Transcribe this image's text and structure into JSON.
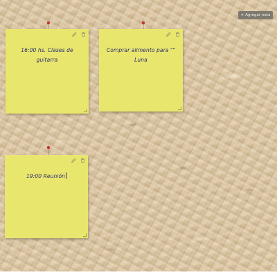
{
  "toolbar": {
    "add_note_label": "Agregar nota",
    "add_note_icon": "plus-icon"
  },
  "notes": [
    {
      "text": "16:00 hs. Clases de guitarra",
      "editing": false
    },
    {
      "text": "Comprar alimento para \"\" Luna",
      "editing": false
    },
    {
      "text": "19:00 Reunión",
      "editing": true
    }
  ],
  "note_actions": {
    "edit_icon": "pencil-icon",
    "delete_icon": "trash-icon"
  },
  "colors": {
    "note_background": "#e9e66e",
    "note_text": "#2a2e6e",
    "pin": "#c8302a",
    "button_background": "#7f7a70"
  }
}
